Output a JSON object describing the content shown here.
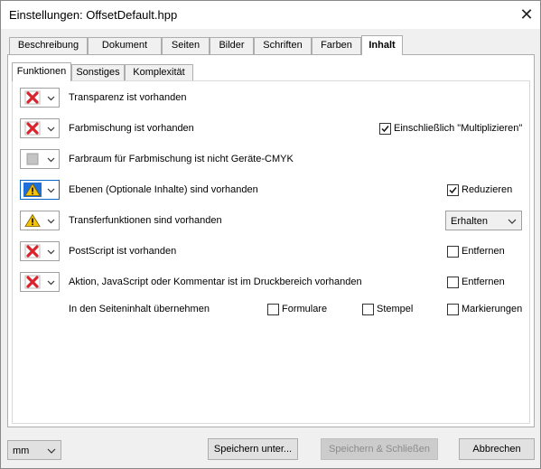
{
  "window": {
    "title": "Einstellungen:  OffsetDefault.hpp",
    "close_glyph": "✕"
  },
  "outer_tabs": [
    "Beschreibung",
    "Dokument",
    "Seiten",
    "Bilder",
    "Schriften",
    "Farben",
    "Inhalt"
  ],
  "outer_tab_active": "Inhalt",
  "inner_tabs": [
    "Funktionen",
    "Sonstiges",
    "Komplexität"
  ],
  "inner_tab_active": "Funktionen",
  "rows": [
    {
      "icon": "red-x-icon",
      "label": "Transparenz ist vorhanden"
    },
    {
      "icon": "red-x-icon",
      "label": "Farbmischung ist vorhanden",
      "option": {
        "type": "checkbox",
        "label": "Einschließlich \"Multiplizieren\"",
        "checked": true
      }
    },
    {
      "icon": "gray-square-icon",
      "label": "Farbraum für Farbmischung ist nicht Geräte-CMYK"
    },
    {
      "icon": "warning-icon",
      "label": "Ebenen (Optionale Inhalte) sind vorhanden",
      "option": {
        "type": "checkbox",
        "label": "Reduzieren",
        "checked": true
      }
    },
    {
      "icon": "warning-icon",
      "label": "Transferfunktionen sind vorhanden",
      "option": {
        "type": "select",
        "value": "Erhalten"
      }
    },
    {
      "icon": "red-x-icon",
      "label": "PostScript ist vorhanden",
      "option": {
        "type": "checkbox",
        "label": "Entfernen",
        "checked": false
      }
    },
    {
      "icon": "red-x-icon",
      "label": "Aktion, JavaScript oder Kommentar ist im Druckbereich vorhanden",
      "option": {
        "type": "checkbox",
        "label": "Entfernen",
        "checked": false
      }
    }
  ],
  "merge_row": {
    "label": "In den Seiteninhalt übernehmen",
    "options": [
      {
        "label": "Formulare",
        "checked": false
      },
      {
        "label": "Stempel",
        "checked": false
      },
      {
        "label": "Markierungen",
        "checked": false
      }
    ]
  },
  "footer": {
    "unit": "mm",
    "save_as": "Speichern unter...",
    "save_close": "Speichern & Schließen",
    "cancel": "Abbrechen"
  },
  "colors": {
    "red_x": "#d9232d",
    "warning_yellow": "#f5c400",
    "warning_blue_bg": "#1e6fd9",
    "tab_border": "#adadad"
  }
}
